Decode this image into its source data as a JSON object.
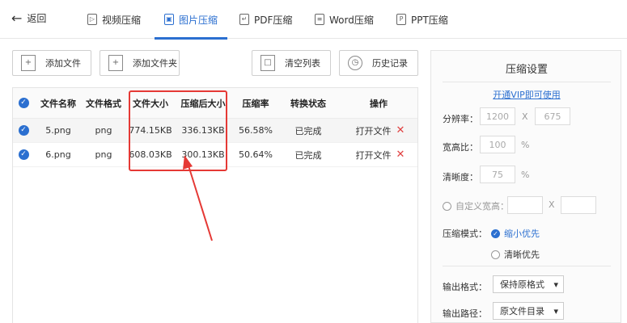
{
  "nav": {
    "back_label": "返回",
    "tabs": [
      {
        "label": "视频压缩",
        "icon": "play-icon"
      },
      {
        "label": "图片压缩",
        "icon": "image-icon"
      },
      {
        "label": "PDF压缩",
        "icon": "pdf-icon"
      },
      {
        "label": "Word压缩",
        "icon": "word-icon"
      },
      {
        "label": "PPT压缩",
        "icon": "ppt-icon"
      }
    ],
    "active_tab": "图片压缩",
    "accent_color": "#2b6fd0"
  },
  "toolbar": {
    "add_file": "添加文件",
    "add_folder": "添加文件夹",
    "clear_list": "清空列表",
    "history": "历史记录"
  },
  "table": {
    "headers": [
      "文件名称",
      "文件格式",
      "文件大小",
      "压缩后大小",
      "压缩率",
      "转换状态",
      "操作"
    ],
    "rows": [
      {
        "name": "5.png",
        "format": "png",
        "size": "774.15KB",
        "compressed": "336.13KB",
        "ratio": "56.58%",
        "status": "已完成",
        "action": "打开文件"
      },
      {
        "name": "6.png",
        "format": "png",
        "size": "608.03KB",
        "compressed": "300.13KB",
        "ratio": "50.64%",
        "status": "已完成",
        "action": "打开文件"
      }
    ],
    "highlight_color": "#e53935"
  },
  "settings": {
    "title": "压缩设置",
    "vip_link": "开通VIP即可使用",
    "resolution_label": "分辨率：",
    "resolution_w": "1200",
    "resolution_x": "X",
    "resolution_h": "675",
    "aspect_label": "宽高比：",
    "aspect_value": "100",
    "aspect_unit": "%",
    "clarity_label": "清晰度：",
    "clarity_value": "75",
    "clarity_unit": "%",
    "custom_label": "自定义宽高：",
    "custom_x": "X",
    "mode_label": "压缩模式：",
    "mode_small": "缩小优先",
    "mode_clear": "清晰优先",
    "format_label": "输出格式：",
    "format_value": "保持原格式",
    "path_label": "输出路径：",
    "path_value": "原文件目录"
  }
}
